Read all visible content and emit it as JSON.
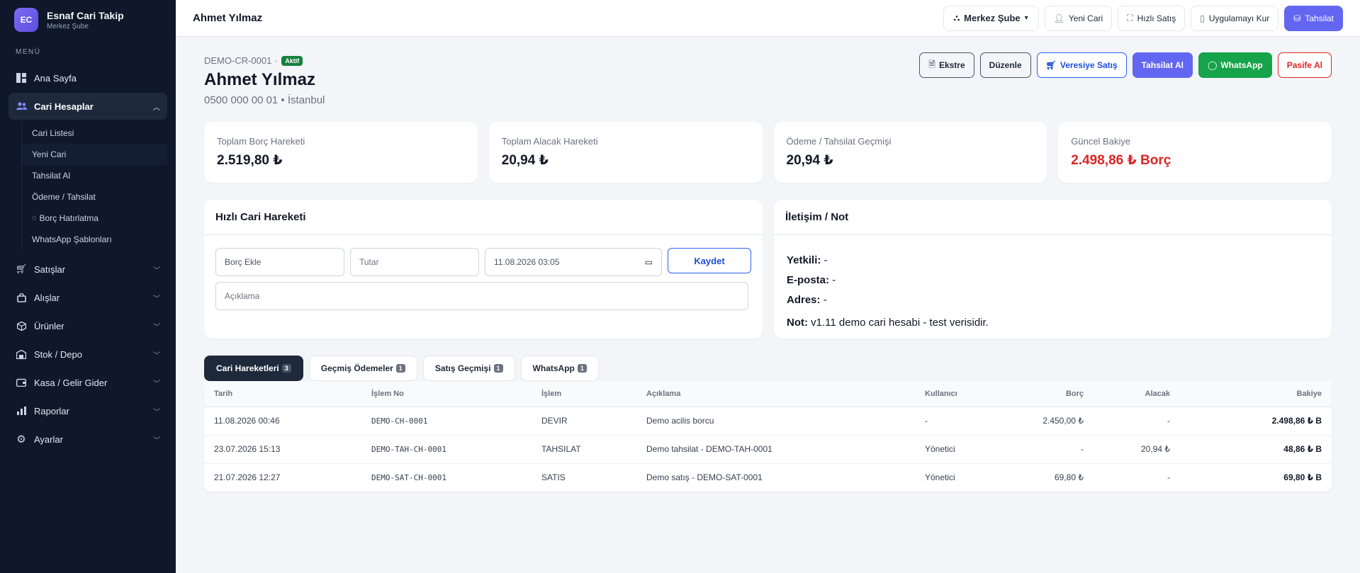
{
  "brand": {
    "logo": "EC",
    "title": "Esnaf Cari Takip",
    "subtitle": "Merkez Şube"
  },
  "sidebar": {
    "menu_header": "MENÜ",
    "items": [
      {
        "label": "Ana Sayfa",
        "icon": "dashboard-icon"
      },
      {
        "label": "Cari Hesaplar",
        "icon": "users-icon",
        "active": true,
        "children": [
          "Cari Listesi",
          "Yeni Cari",
          "Tahsilat Al",
          "Ödeme / Tahsilat",
          "Borç Hatırlatma",
          "WhatsApp Şablonları"
        ]
      },
      {
        "label": "Satışlar",
        "icon": "cart-icon"
      },
      {
        "label": "Alışlar",
        "icon": "bag-icon"
      },
      {
        "label": "Ürünler",
        "icon": "box-icon"
      },
      {
        "label": "Stok / Depo",
        "icon": "warehouse-icon"
      },
      {
        "label": "Kasa / Gelir Gider",
        "icon": "wallet-icon"
      },
      {
        "label": "Raporlar",
        "icon": "chart-icon"
      },
      {
        "label": "Ayarlar",
        "icon": "gear-icon"
      }
    ]
  },
  "topbar": {
    "title": "Ahmet Yılmaz",
    "branch": "Merkez Şube",
    "actions": {
      "new_cari": "Yeni Cari",
      "quick_sale": "Hızlı Satış",
      "install_app": "Uygulamayı Kur",
      "collect": "Tahsilat"
    }
  },
  "cari": {
    "code": "DEMO-CR-0001 ·",
    "status": "Aktif",
    "name": "Ahmet Yılmaz",
    "meta": "0500 000 00 01 • İstanbul",
    "actions": {
      "statement": "Ekstre",
      "edit": "Düzenle",
      "credit_sale": "Veresiye Satış",
      "collect": "Tahsilat Al",
      "whatsapp": "WhatsApp",
      "deactivate": "Pasife Al"
    }
  },
  "stats": [
    {
      "label": "Toplam Borç Hareketi",
      "value": "2.519,80 ₺"
    },
    {
      "label": "Toplam Alacak Hareketi",
      "value": "20,94 ₺"
    },
    {
      "label": "Ödeme / Tahsilat Geçmişi",
      "value": "20,94 ₺"
    },
    {
      "label": "Güncel Bakiye",
      "value": "2.498,86 ₺ Borç"
    }
  ],
  "colors": {
    "accent": "#6366f1",
    "danger": "#dc2626",
    "success": "#16a34a",
    "sidebar": "#0f172a"
  },
  "quick": {
    "title": "Hızlı Cari Hareketi",
    "type_value": "Borç Ekle",
    "amount_placeholder": "Tutar",
    "datetime_value": "11.08.2026 03:05",
    "save_label": "Kaydet",
    "desc_placeholder": "Açıklama"
  },
  "contact": {
    "title": "İletişim / Not",
    "authorized_label": "Yetkili:",
    "authorized": "-",
    "email_label": "E-posta:",
    "email": "-",
    "address_label": "Adres:",
    "address": "-",
    "note_label": "Not:",
    "note": "v1.11 demo cari hesabi - test verisidir."
  },
  "tabs": [
    {
      "label": "Cari Hareketleri",
      "count": "3"
    },
    {
      "label": "Geçmiş Ödemeler",
      "count": "1"
    },
    {
      "label": "Satış Geçmişi",
      "count": "1"
    },
    {
      "label": "WhatsApp",
      "count": "1"
    }
  ],
  "table": {
    "columns": [
      "Tarih",
      "İşlem No",
      "İşlem",
      "Açıklama",
      "Kullanıcı",
      "Borç",
      "Alacak",
      "Bakiye"
    ],
    "rows": [
      [
        "11.08.2026 00:46",
        "DEMO-CH-0001",
        "DEVIR",
        "Demo acilis borcu",
        "-",
        "2.450,00 ₺",
        "-",
        "2.498,86 ₺ B"
      ],
      [
        "23.07.2026 15:13",
        "DEMO-TAH-CH-0001",
        "TAHSILAT",
        "Demo tahsilat - DEMO-TAH-0001",
        "Yönetici",
        "-",
        "20,94 ₺",
        "48,86 ₺ B"
      ],
      [
        "21.07.2026 12:27",
        "DEMO-SAT-CH-0001",
        "SATIS",
        "Demo satış - DEMO-SAT-0001",
        "Yönetici",
        "69,80 ₺",
        "-",
        "69,80 ₺ B"
      ]
    ]
  }
}
